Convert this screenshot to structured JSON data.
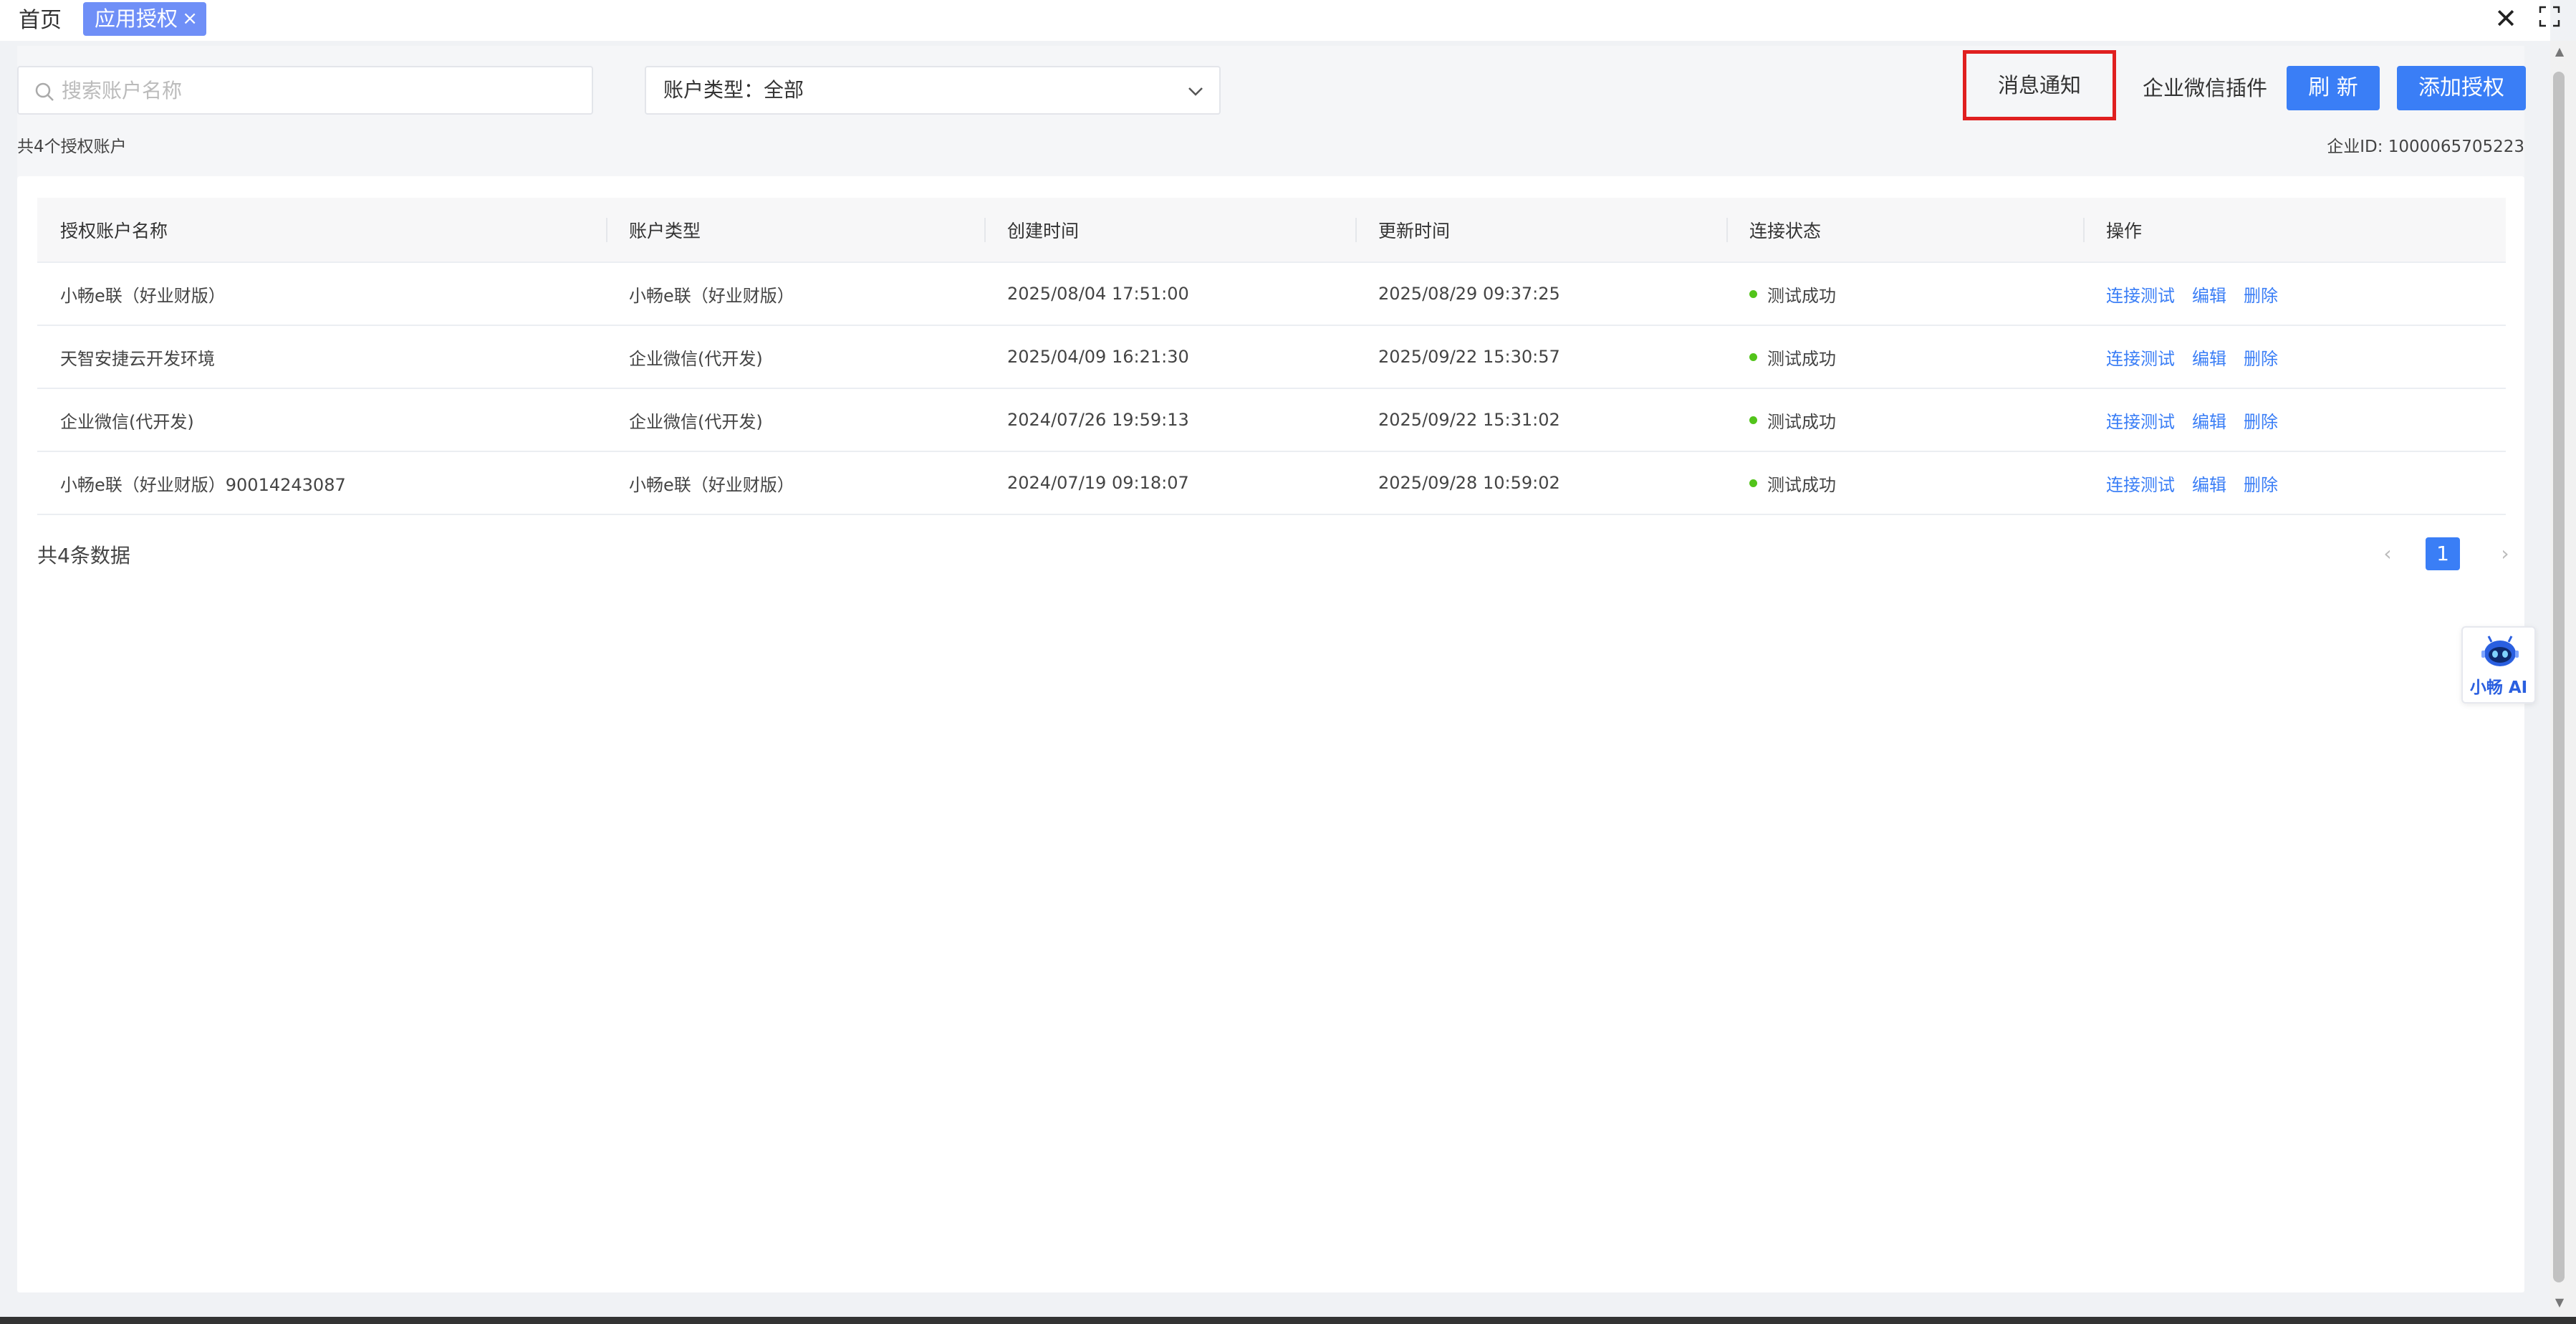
{
  "tabs": {
    "home_label": "首页",
    "active_label": "应用授权",
    "active_close": "×",
    "window_close": "✕"
  },
  "toolbar": {
    "search_placeholder": "搜索账户名称",
    "search_value": "",
    "account_type_label": "账户类型：全部",
    "notify_label": "消息通知",
    "plugin_label": "企业微信插件",
    "refresh_label": "刷 新",
    "add_label": "添加授权"
  },
  "summary": {
    "count_text": "共4个授权账户",
    "corp_id_text": "企业ID: 1000065705223"
  },
  "table": {
    "columns": [
      "授权账户名称",
      "账户类型",
      "创建时间",
      "更新时间",
      "连接状态",
      "操作"
    ],
    "rows": [
      {
        "name": "小畅e联（好业财版）",
        "type": "小畅e联（好业财版）",
        "created": "2025/08/04 17:51:00",
        "updated": "2025/08/29 09:37:25",
        "status": "测试成功"
      },
      {
        "name": "天智安捷云开发环境",
        "type": "企业微信(代开发)",
        "created": "2025/04/09 16:21:30",
        "updated": "2025/09/22 15:30:57",
        "status": "测试成功"
      },
      {
        "name": "企业微信(代开发)",
        "type": "企业微信(代开发)",
        "created": "2024/07/26 19:59:13",
        "updated": "2025/09/22 15:31:02",
        "status": "测试成功"
      },
      {
        "name": "小畅e联（好业财版）90014243087",
        "type": "小畅e联（好业财版）",
        "created": "2024/07/19 09:18:07",
        "updated": "2025/09/28 10:59:02",
        "status": "测试成功"
      }
    ],
    "actions": [
      "连接测试",
      "编辑",
      "删除"
    ],
    "status_color": "#52c41a"
  },
  "pagination": {
    "total_text": "共4条数据",
    "current_page": "1",
    "prev": "‹",
    "next": "›"
  },
  "ai_widget": {
    "label": "小畅 AI"
  },
  "colors": {
    "primary": "#3a7ef6",
    "tab_active": "#6f8ff7",
    "highlight_border": "#e02020"
  }
}
